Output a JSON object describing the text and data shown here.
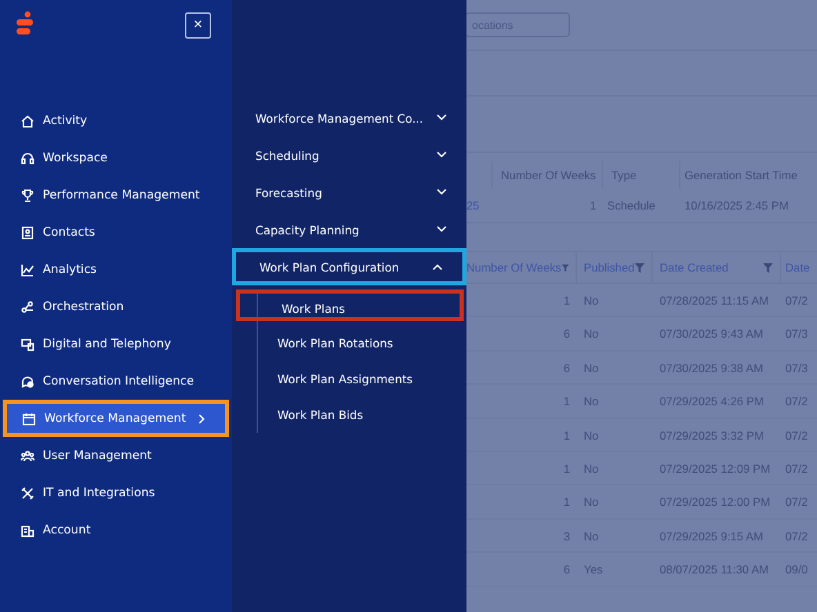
{
  "close_button": {
    "label": "×"
  },
  "main_menu": [
    {
      "label": "Activity",
      "selected": false
    },
    {
      "label": "Workspace",
      "selected": false
    },
    {
      "label": "Performance Management",
      "selected": false
    },
    {
      "label": "Contacts",
      "selected": false
    },
    {
      "label": "Analytics",
      "selected": false
    },
    {
      "label": "Orchestration",
      "selected": false
    },
    {
      "label": "Digital and Telephony",
      "selected": false
    },
    {
      "label": "Conversation Intelligence",
      "selected": false
    },
    {
      "label": "Workforce Management",
      "selected": true,
      "color": "#f7931e"
    },
    {
      "label": "User Management",
      "selected": false
    },
    {
      "label": "IT and Integrations",
      "selected": false
    },
    {
      "label": "Account",
      "selected": false
    }
  ],
  "sub_menu": [
    {
      "label": "Workforce Management Co...",
      "expanded": false
    },
    {
      "label": "Scheduling",
      "expanded": false
    },
    {
      "label": "Forecasting",
      "expanded": false
    },
    {
      "label": "Capacity Planning",
      "expanded": false
    },
    {
      "label": "Work Plan Configuration",
      "expanded": true,
      "color": "#1ea7e1",
      "children": [
        {
          "label": "Work Plans",
          "color": "#c8321e"
        },
        {
          "label": "Work Plan Rotations"
        },
        {
          "label": "Work Plan Assignments"
        },
        {
          "label": "Work Plan Bids"
        }
      ]
    }
  ],
  "background": {
    "search": {
      "placeholder": "ocations"
    },
    "schedule_table": {
      "columns": [
        "",
        "Number Of Weeks",
        "Type",
        "Generation Start Time"
      ],
      "rows": [
        [
          "25",
          "1",
          "Schedule",
          "10/16/2025 2:45 PM"
        ]
      ]
    },
    "work_plans_table": {
      "columns": [
        "Number Of Weeks",
        "Published",
        "Date Created",
        "Date"
      ],
      "rows": [
        [
          "1",
          "No",
          "07/28/2025 11:15 AM",
          "07/2"
        ],
        [
          "6",
          "No",
          "07/30/2025 9:43 AM",
          "07/3"
        ],
        [
          "6",
          "No",
          "07/30/2025 9:38 AM",
          "07/3"
        ],
        [
          "1",
          "No",
          "07/29/2025 4:26 PM",
          "07/2"
        ],
        [
          "1",
          "No",
          "07/29/2025 3:32 PM",
          "07/2"
        ],
        [
          "1",
          "No",
          "07/29/2025 12:09 PM",
          "07/2"
        ],
        [
          "1",
          "No",
          "07/29/2025 12:00 PM",
          "07/2"
        ],
        [
          "3",
          "No",
          "07/29/2025 9:15 AM",
          "07/2"
        ],
        [
          "6",
          "Yes",
          "08/07/2025 11:30 AM",
          "09/0"
        ]
      ]
    }
  }
}
